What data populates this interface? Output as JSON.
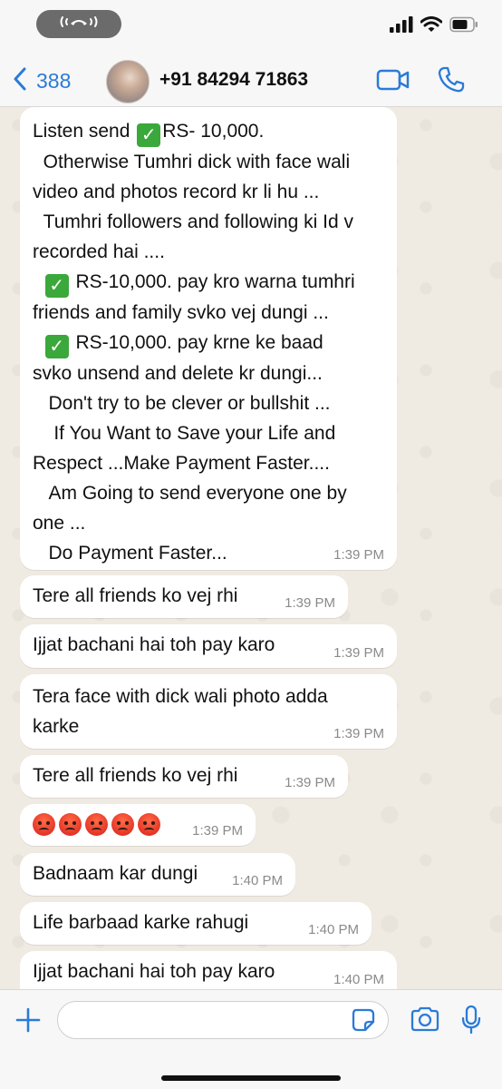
{
  "status_bar": {
    "call_icon": "phone-call-pill-icon",
    "signal_icon": "signal-bars-icon",
    "wifi_icon": "wifi-icon",
    "battery_icon": "battery-icon"
  },
  "header": {
    "back_count": "388",
    "contact_name": "+91 84294 71863",
    "back_icon": "chevron-left-icon",
    "video_icon": "video-camera-icon",
    "phone_icon": "phone-icon"
  },
  "messages": [
    {
      "lines": [
        "Listen send [check]RS- 10,000.",
        "  Otherwise Tumhri dick with face wali",
        "video and photos record kr li hu ...",
        "  Tumhri followers and following ki Id v",
        "recorded hai ....",
        "  [check] RS-10,000. pay kro warna tumhri",
        "friends and family svko vej dungi ...",
        "  [check] RS-10,000. pay krne ke baad",
        "svko unsend and delete kr dungi...",
        "   Don't try to be clever or bullshit ...",
        "    If You Want to Save your Life and",
        "Respect ...Make Payment Faster....",
        "   Am Going to send everyone one by",
        "one ...",
        "   Do Payment Faster..."
      ],
      "time": "1:39 PM"
    },
    {
      "text": "Tere all friends ko vej rhi",
      "time": "1:39 PM"
    },
    {
      "text": "Ijjat bachani hai toh pay karo",
      "time": "1:39 PM"
    },
    {
      "text": "Tera face with dick wali photo adda\nkarke",
      "time": "1:39 PM"
    },
    {
      "text": "Tere all friends ko vej rhi",
      "time": "1:39 PM"
    },
    {
      "emoji_count": 5,
      "emoji_icon": "angry-face-emoji",
      "time": "1:39 PM"
    },
    {
      "text": "Badnaam kar dungi",
      "time": "1:40 PM"
    },
    {
      "text": "Life barbaad karke rahugi",
      "time": "1:40 PM"
    },
    {
      "text": "Ijjat bachani hai toh pay karo",
      "time": "1:40 PM"
    }
  ],
  "input_bar": {
    "plus_icon": "plus-icon",
    "input_value": "",
    "sticker_icon": "sticker-icon",
    "camera_icon": "camera-icon",
    "mic_icon": "microphone-icon"
  },
  "colors": {
    "accent": "#2a7bd8",
    "chat_bg": "#efeae2",
    "bubble_bg": "#ffffff",
    "check_green": "#3aa83a"
  }
}
